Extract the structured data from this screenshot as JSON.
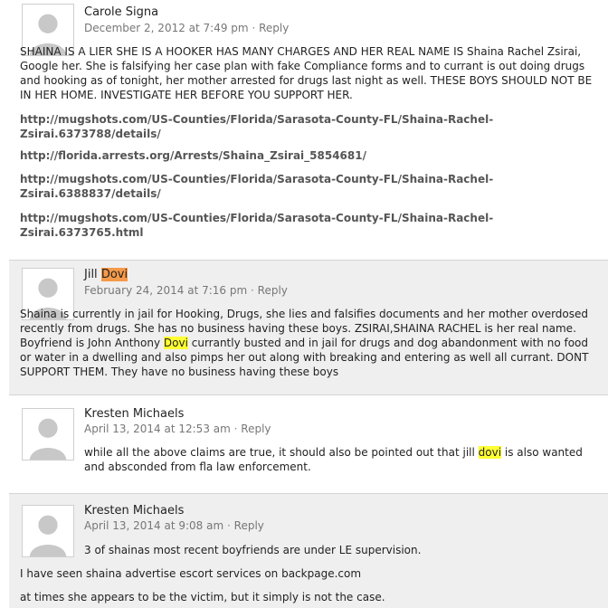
{
  "comments": [
    {
      "author": "Carole Signa",
      "date": "December 2, 2012 at 7:49 pm",
      "reply": "Reply",
      "body": "SHAINA IS A LIER SHE IS A HOOKER HAS MANY CHARGES AND HER REAL NAME IS Shaina Rachel Zsirai, Google her. She is falsifying her case plan with fake Compliance forms and to currant is out doing drugs and hooking as of tonight, her mother arrested for drugs last night as well. THESE BOYS SHOULD NOT BE IN HER HOME. INVESTIGATE HER BEFORE YOU SUPPORT HER.",
      "links": [
        "http://mugshots.com/US-Counties/Florida/Sarasota-County-FL/Shaina-Rachel-Zsirai.6373788/details/",
        "http://florida.arrests.org/Arrests/Shaina_Zsirai_5854681/",
        "http://mugshots.com/US-Counties/Florida/Sarasota-County-FL/Shaina-Rachel-Zsirai.6388837/details/",
        "http://mugshots.com/US-Counties/Florida/Sarasota-County-FL/Shaina-Rachel-Zsirai.6373765.html"
      ]
    },
    {
      "author_first": "Jill ",
      "author_highlight": "Dovi",
      "date": "February 24, 2014 at 7:16 pm",
      "reply": "Reply",
      "body_a": "Shaina is currently in jail for Hooking, Drugs, she lies and falsifies documents and her mother overdosed recently from drugs. She has no business having these boys. ZSIRAI,SHAINA RACHEL is her real name. Boyfriend is John Anthony ",
      "body_highlight": "Dovi",
      "body_b": " currantly busted and in jail for drugs and dog abandonment with no food or water in a dwelling and also pimps her out along with breaking and entering as well all currant. DONT SUPPORT THEM. They have no business having these boys"
    },
    {
      "author": "Kresten Michaels",
      "date": "April 13, 2014 at 12:53 am",
      "reply": "Reply",
      "body_a": "while all the above claims are true, it should also be pointed out that jill ",
      "body_highlight": "dovi",
      "body_b": " is also wanted and absconded from fla law enforcement."
    },
    {
      "author": "Kresten Michaels",
      "date": "April 13, 2014 at 9:08 am",
      "reply": "Reply",
      "body_1": "3 of shainas most recent boyfriends are under LE supervision.",
      "body_2": "I have seen shaina advertise escort services on backpage.com",
      "body_3": "at times she appears to be the victim, but it simply is not the case."
    }
  ],
  "separator": "·"
}
